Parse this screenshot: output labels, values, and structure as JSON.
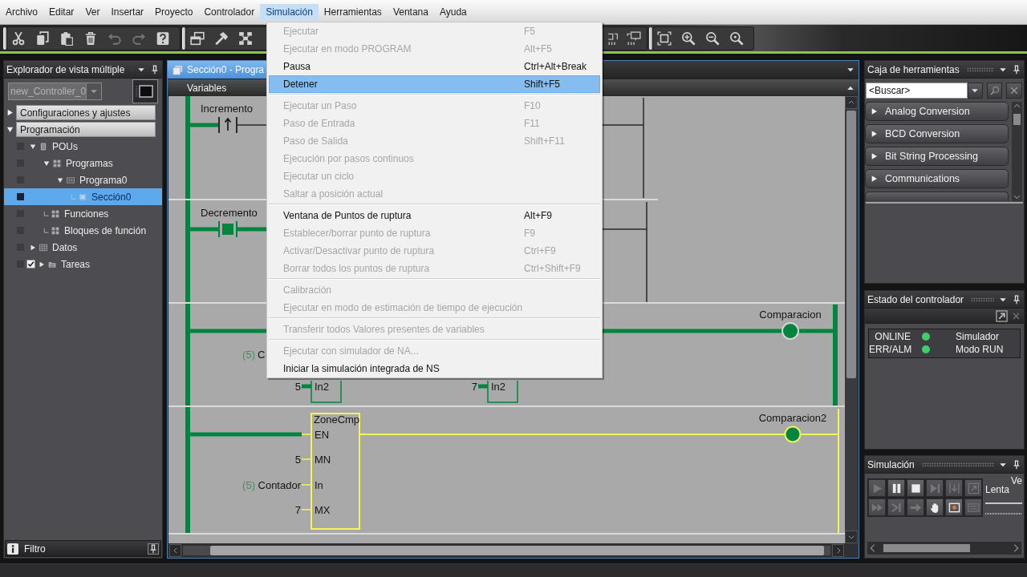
{
  "menu_bar": [
    {
      "label": "Archivo",
      "selected": false
    },
    {
      "label": "Editar",
      "selected": false
    },
    {
      "label": "Ver",
      "selected": false
    },
    {
      "label": "Insertar",
      "selected": false
    },
    {
      "label": "Proyecto",
      "selected": false
    },
    {
      "label": "Controlador",
      "selected": false
    },
    {
      "label": "Simulación",
      "selected": true
    },
    {
      "label": "Herramientas",
      "selected": false
    },
    {
      "label": "Ventana",
      "selected": false
    },
    {
      "label": "Ayuda",
      "selected": false
    }
  ],
  "menu": {
    "groups": [
      {
        "items": [
          {
            "label": "Ejecutar",
            "shortcut": "F5",
            "disabled": true,
            "selected": false
          },
          {
            "label": "Ejecutar en modo PROGRAM",
            "shortcut": "Alt+F5",
            "disabled": true,
            "selected": false
          },
          {
            "label": "Pausa",
            "shortcut": "Ctrl+Alt+Break",
            "disabled": false,
            "selected": false
          },
          {
            "label": "Detener",
            "shortcut": "Shift+F5",
            "disabled": false,
            "selected": true
          }
        ]
      },
      {
        "items": [
          {
            "label": "Ejecutar un Paso",
            "shortcut": "F10",
            "disabled": true,
            "selected": false
          },
          {
            "label": "Paso de Entrada",
            "shortcut": "F11",
            "disabled": true,
            "selected": false
          },
          {
            "label": "Paso de Salida",
            "shortcut": "Shift+F11",
            "disabled": true,
            "selected": false
          },
          {
            "label": "Ejecución por pasos continuos",
            "disabled": true,
            "selected": false
          },
          {
            "label": "Ejecutar un ciclo",
            "disabled": true,
            "selected": false
          },
          {
            "label": "Saltar a posición actual",
            "disabled": true,
            "selected": false
          }
        ]
      },
      {
        "items": [
          {
            "label": "Ventana de Puntos de ruptura",
            "shortcut": "Alt+F9",
            "disabled": false,
            "selected": false
          },
          {
            "label": "Establecer/borrar punto de ruptura",
            "shortcut": "F9",
            "disabled": true,
            "selected": false
          },
          {
            "label": "Activar/Desactivar punto de ruptura",
            "shortcut": "Ctrl+F9",
            "disabled": true,
            "selected": false
          },
          {
            "label": "Borrar todos los puntos de ruptura",
            "shortcut": "Ctrl+Shift+F9",
            "disabled": true,
            "selected": false
          }
        ]
      },
      {
        "items": [
          {
            "label": "Calibración",
            "disabled": true,
            "selected": false
          },
          {
            "label": "Ejecutar en modo de estimación de tiempo de ejecución",
            "disabled": true,
            "selected": false
          }
        ]
      },
      {
        "items": [
          {
            "label": "Transferir todos Valores presentes de variables",
            "disabled": true,
            "selected": false
          }
        ]
      },
      {
        "items": [
          {
            "label": "Ejecutar con simulador de NA...",
            "disabled": true,
            "selected": false
          },
          {
            "label": "Iniciar la simulación integrada de NS",
            "disabled": false,
            "selected": false
          }
        ]
      }
    ]
  },
  "toolbar": {
    "groups": [
      {
        "buttons": [
          {
            "kind": "cut",
            "disabled": false
          },
          {
            "kind": "copy",
            "disabled": false
          },
          {
            "kind": "paste",
            "disabled": false
          },
          {
            "kind": "delete",
            "disabled": false
          },
          {
            "kind": "undo",
            "disabled": true
          },
          {
            "kind": "redo",
            "disabled": true
          },
          {
            "kind": "help",
            "disabled": false
          }
        ]
      },
      {
        "buttons": [
          {
            "kind": "windows",
            "disabled": false
          },
          {
            "kind": "build",
            "disabled": false
          },
          {
            "kind": "transfer",
            "disabled": false
          }
        ],
        "trailing_buttons": [
          {
            "kind": "device",
            "disabled": false
          },
          {
            "kind": "monitor",
            "disabled": false
          }
        ]
      },
      {
        "buttons": [
          {
            "kind": "fit",
            "disabled": false
          },
          {
            "kind": "zoomin",
            "disabled": false
          },
          {
            "kind": "zoomout",
            "disabled": false
          },
          {
            "kind": "zoom100",
            "disabled": false
          }
        ]
      }
    ]
  },
  "explorer": {
    "title": "Explorador de vista múltiple",
    "controller": {
      "label": "new_Controller_0",
      "disabled": true
    },
    "sections": [
      {
        "label": "Configuraciones y ajustes",
        "expanded": false
      },
      {
        "label": "Programación",
        "expanded": true,
        "tree": [
          {
            "label": "POUs",
            "kind": "stack",
            "expanded": true,
            "selected": false,
            "children": [
              {
                "label": "Programas",
                "kind": "group",
                "expanded": true,
                "selected": false,
                "children": [
                  {
                    "label": "Programa0",
                    "kind": "program",
                    "expanded": true,
                    "selected": false,
                    "children": [
                      {
                        "label": "Sección0",
                        "kind": "section",
                        "selected": true
                      }
                    ]
                  }
                ]
              },
              {
                "label": "Funciones",
                "kind": "group",
                "selected": false
              },
              {
                "label": "Bloques de función",
                "kind": "group",
                "selected": false
              }
            ]
          },
          {
            "label": "Datos",
            "kind": "table",
            "expanded": false,
            "selected": false
          },
          {
            "label": "Tareas",
            "kind": "folder",
            "expanded": false,
            "selected": false,
            "checked": true
          }
        ]
      }
    ],
    "filter": "Filtro"
  },
  "editor": {
    "tab": {
      "label": "Sección0 - Progra",
      "selected": true
    },
    "variables": "Variables",
    "ladder": {
      "rungs": [
        {
          "kind": "contact",
          "selected": false,
          "powered": true,
          "contact": {
            "label": "Incremento",
            "rising_edge": true,
            "on": false
          }
        },
        {
          "kind": "contact",
          "selected": false,
          "powered": true,
          "contact": {
            "label": "Decremento",
            "on": true
          }
        },
        {
          "kind": "compare",
          "selected": false,
          "powered": true,
          "input": {
            "value": "(5)",
            "variable": "C"
          },
          "pins": [
            {
              "value": "5",
              "name": "In2"
            },
            {
              "value": "7",
              "name": "In2"
            }
          ],
          "coil": {
            "label": "Comparacion",
            "on": true
          }
        },
        {
          "kind": "block",
          "selected": true,
          "powered": true,
          "block": {
            "name": "ZoneCmp",
            "pins": [
              {
                "name": "EN"
              },
              {
                "name": "MN",
                "value": "5"
              },
              {
                "name": "In",
                "value": "(5)",
                "variable": "Contador"
              },
              {
                "name": "MX",
                "value": "7"
              }
            ]
          },
          "coil": {
            "label": "Comparacion2",
            "on": true
          }
        }
      ]
    }
  },
  "toolbox": {
    "title": "Caja de herramientas",
    "search": {
      "placeholder": "<Buscar>"
    },
    "categories": [
      {
        "label": "Analog Conversion",
        "expanded": false
      },
      {
        "label": "BCD Conversion",
        "expanded": false
      },
      {
        "label": "Bit String Processing",
        "expanded": false
      },
      {
        "label": "Communications",
        "expanded": false
      }
    ]
  },
  "controller_status": {
    "title": "Estado del controlador",
    "indicators": [
      {
        "label": "ONLINE",
        "color": "#3ccf6a",
        "value": "Simulador"
      },
      {
        "label": "ERR/ALM",
        "color": "#3ccf6a",
        "value": "Modo RUN"
      }
    ]
  },
  "simulation": {
    "title": "Simulación",
    "buttons": [
      {
        "kind": "play",
        "disabled": true
      },
      {
        "kind": "pause",
        "disabled": false
      },
      {
        "kind": "stop",
        "disabled": false
      },
      {
        "kind": "step",
        "disabled": true
      },
      {
        "kind": "stepin",
        "disabled": true
      },
      {
        "kind": "stepout",
        "disabled": true
      },
      {
        "kind": "fast",
        "disabled": true
      },
      {
        "kind": "toend",
        "disabled": true
      },
      {
        "kind": "jump",
        "disabled": true
      },
      {
        "kind": "hand",
        "disabled": false
      },
      {
        "kind": "record",
        "disabled": false
      },
      {
        "kind": "var",
        "disabled": true
      }
    ],
    "speed_heading": "Ve",
    "speed_label": "Lenta"
  }
}
